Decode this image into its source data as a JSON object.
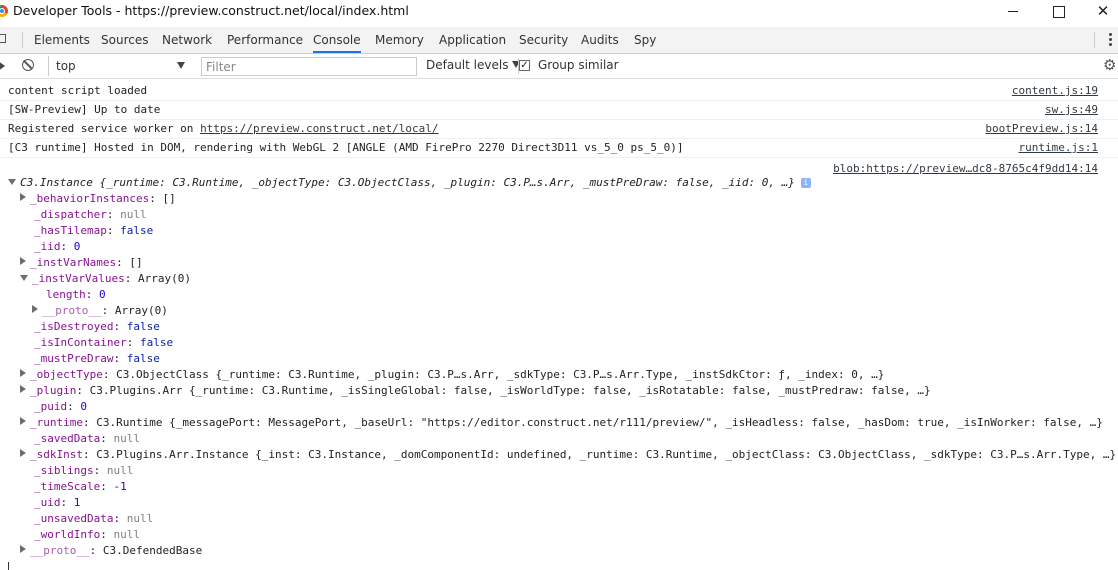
{
  "window": {
    "title": "Developer Tools - https://preview.construct.net/local/index.html"
  },
  "tabs": [
    {
      "label": "Elements"
    },
    {
      "label": "Sources"
    },
    {
      "label": "Network"
    },
    {
      "label": "Performance"
    },
    {
      "label": "Console",
      "active": true
    },
    {
      "label": "Memory"
    },
    {
      "label": "Application"
    },
    {
      "label": "Security"
    },
    {
      "label": "Audits"
    },
    {
      "label": "Spy"
    }
  ],
  "toolbar": {
    "context": "top",
    "filter_placeholder": "Filter",
    "levels_label": "Default levels",
    "group_similar_label": "Group similar",
    "group_similar_checked": true
  },
  "messages": [
    {
      "text": "content script loaded",
      "source": "content.js:19"
    },
    {
      "text": "[SW-Preview] Up to date",
      "source": "sw.js:49"
    },
    {
      "text_prefix": "Registered service worker on ",
      "link": "https://preview.construct.net/local/",
      "source": "bootPreview.js:14"
    },
    {
      "text": "[C3 runtime] Hosted in DOM, rendering with WebGL 2 [ANGLE (AMD FirePro 2270 Direct3D11 vs_5_0 ps_5_0)]",
      "source": "runtime.js:1"
    }
  ],
  "blob_source": "blob:https://preview…dc8-8765c4f9dd14:14",
  "object": {
    "summary": "C3.Instance {_runtime: C3.Runtime, _objectType: C3.ObjectClass, _plugin: C3.P…s.Arr, _mustPreDraw: false, _iid: 0, …}",
    "info_badge": "i",
    "props": [
      {
        "key": "_behaviorInstances",
        "value": "[]",
        "type": "plain",
        "expander": "right",
        "indent": 1
      },
      {
        "key": "_dispatcher",
        "value": "null",
        "type": "nul",
        "expander": "none",
        "indent": 1
      },
      {
        "key": "_hasTilemap",
        "value": "false",
        "type": "bool",
        "expander": "none",
        "indent": 1
      },
      {
        "key": "_iid",
        "value": "0",
        "type": "num",
        "expander": "none",
        "indent": 1
      },
      {
        "key": "_instVarNames",
        "value": "[]",
        "type": "plain",
        "expander": "right",
        "indent": 1
      },
      {
        "key": "_instVarValues",
        "value": "Array(0)",
        "type": "plain",
        "expander": "down",
        "indent": 1
      },
      {
        "key": "length",
        "value": "0",
        "type": "num",
        "expander": "none",
        "indent": 2
      },
      {
        "key": "__proto__",
        "value": "Array(0)",
        "type": "plain",
        "expander": "right",
        "indent": 2,
        "dim": true
      },
      {
        "key": "_isDestroyed",
        "value": "false",
        "type": "bool",
        "expander": "none",
        "indent": 1
      },
      {
        "key": "_isInContainer",
        "value": "false",
        "type": "bool",
        "expander": "none",
        "indent": 1
      },
      {
        "key": "_mustPreDraw",
        "value": "false",
        "type": "bool",
        "expander": "none",
        "indent": 1
      },
      {
        "key": "_objectType",
        "value": "C3.ObjectClass {_runtime: C3.Runtime, _plugin: C3.P…s.Arr, _sdkType: C3.P…s.Arr.Type, _instSdkCtor: ƒ, _index: 0, …}",
        "type": "plain",
        "expander": "right",
        "indent": 1
      },
      {
        "key": "_plugin",
        "value": "C3.Plugins.Arr {_runtime: C3.Runtime, _isSingleGlobal: false, _isWorldType: false, _isRotatable: false, _mustPredraw: false, …}",
        "type": "plain",
        "expander": "right",
        "indent": 1
      },
      {
        "key": "_puid",
        "value": "0",
        "type": "num",
        "expander": "none",
        "indent": 1
      },
      {
        "key": "_runtime",
        "value": "C3.Runtime {_messagePort: MessagePort, _baseUrl: \"https://editor.construct.net/r111/preview/\", _isHeadless: false, _hasDom: true, _isInWorker: false, …}",
        "type": "plain",
        "expander": "right",
        "indent": 1
      },
      {
        "key": "_savedData",
        "value": "null",
        "type": "nul",
        "expander": "none",
        "indent": 1
      },
      {
        "key": "_sdkInst",
        "value": "C3.Plugins.Arr.Instance {_inst: C3.Instance, _domComponentId: undefined, _runtime: C3.Runtime, _objectClass: C3.ObjectClass, _sdkType: C3.P…s.Arr.Type, …}",
        "type": "plain",
        "expander": "right",
        "indent": 1
      },
      {
        "key": "_siblings",
        "value": "null",
        "type": "nul",
        "expander": "none",
        "indent": 1
      },
      {
        "key": "_timeScale",
        "value": "-1",
        "type": "num",
        "expander": "none",
        "indent": 1
      },
      {
        "key": "_uid",
        "value": "1",
        "type": "num",
        "expander": "none",
        "indent": 1
      },
      {
        "key": "_unsavedData",
        "value": "null",
        "type": "nul",
        "expander": "none",
        "indent": 1
      },
      {
        "key": "_worldInfo",
        "value": "null",
        "type": "nul",
        "expander": "none",
        "indent": 1
      },
      {
        "key": "__proto__",
        "value": "C3.DefendedBase",
        "type": "plain",
        "expander": "right",
        "indent": 1,
        "dim": true
      }
    ]
  }
}
